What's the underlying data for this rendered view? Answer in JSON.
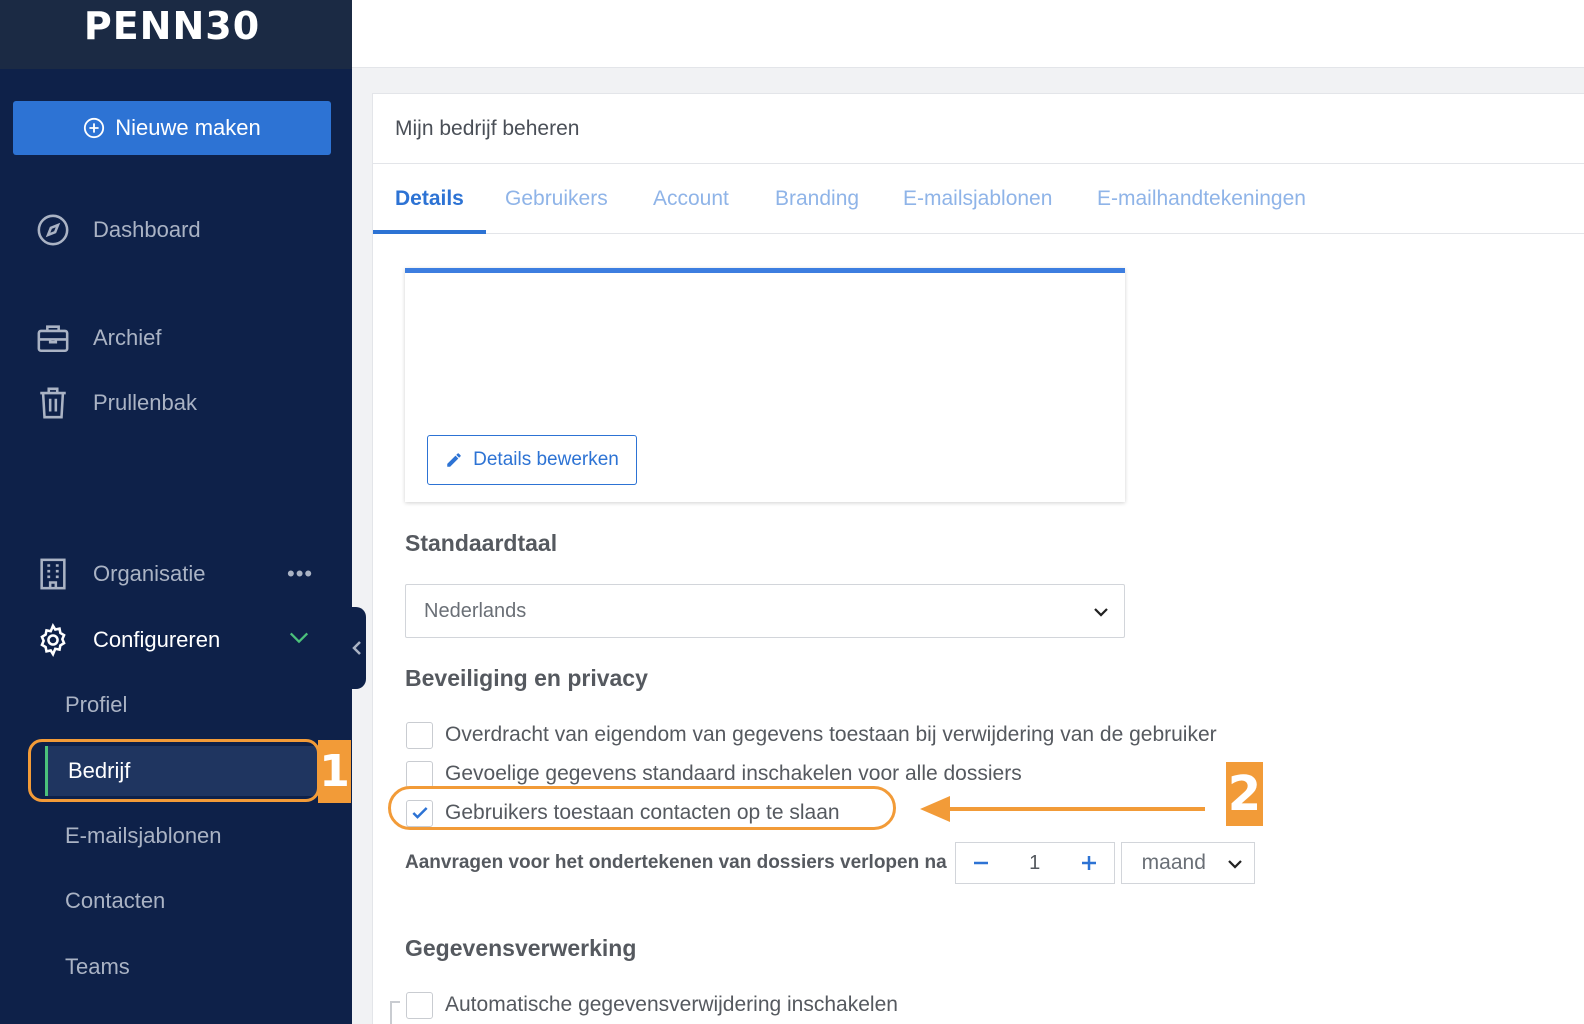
{
  "app": {
    "logo": "PENN30"
  },
  "sidebar": {
    "new_button": "Nieuwe maken",
    "items": [
      {
        "label": "Dashboard",
        "icon": "compass-icon"
      },
      {
        "label": "Archief",
        "icon": "briefcase-icon"
      },
      {
        "label": "Prullenbak",
        "icon": "trash-icon"
      },
      {
        "label": "Organisatie",
        "icon": "building-icon",
        "more": "•••"
      },
      {
        "label": "Configureren",
        "icon": "gear-icon"
      }
    ],
    "sub_items": [
      {
        "label": "Profiel"
      },
      {
        "label": "Bedrijf",
        "active": true
      },
      {
        "label": "E-mailsjablonen"
      },
      {
        "label": "Contacten"
      },
      {
        "label": "Teams"
      }
    ]
  },
  "annotations": {
    "step1": "1",
    "step2": "2",
    "color": "#f29b38"
  },
  "main": {
    "panel_title": "Mijn bedrijf beheren",
    "tabs": [
      {
        "label": "Details",
        "active": true
      },
      {
        "label": "Gebruikers"
      },
      {
        "label": "Account"
      },
      {
        "label": "Branding"
      },
      {
        "label": "E-mailsjablonen"
      },
      {
        "label": "E-mailhandtekeningen"
      }
    ],
    "edit_button": "Details bewerken",
    "language": {
      "title": "Standaardtaal",
      "selected": "Nederlands"
    },
    "security": {
      "title": "Beveiliging en privacy",
      "options": [
        {
          "label": "Overdracht van eigendom van gegevens toestaan bij verwijdering van de gebruiker",
          "checked": false
        },
        {
          "label": "Gevoelige gegevens standaard inschakelen voor alle dossiers",
          "checked": false
        },
        {
          "label": "Gebruikers toestaan contacten op te slaan",
          "checked": true
        }
      ],
      "expire_label": "Aanvragen voor het ondertekenen van dossiers verlopen na",
      "expire_value": "1",
      "expire_unit": "maand"
    },
    "data_processing": {
      "title": "Gegevensverwerking",
      "options": [
        {
          "label": "Automatische gegevensverwijdering inschakelen",
          "checked": false
        }
      ]
    }
  },
  "colors": {
    "sidebar": "#0e2149",
    "accent": "#2d73d4",
    "active_indicator": "#4bc17b"
  }
}
